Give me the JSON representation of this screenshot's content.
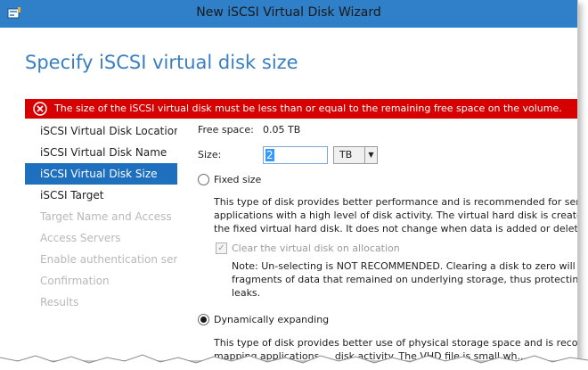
{
  "window": {
    "title": "New iSCSI Virtual Disk Wizard",
    "icon": "wizard-app-icon"
  },
  "page": {
    "title": "Specify iSCSI virtual disk size"
  },
  "error": {
    "icon": "error-x-icon",
    "message": "The size of the iSCSI virtual disk must be less than or equal to the remaining free space on the volume."
  },
  "nav": {
    "items": [
      {
        "label": "iSCSI Virtual Disk Location",
        "state": "normal"
      },
      {
        "label": "iSCSI Virtual Disk Name",
        "state": "normal"
      },
      {
        "label": "iSCSI Virtual Disk Size",
        "state": "selected"
      },
      {
        "label": "iSCSI Target",
        "state": "normal"
      },
      {
        "label": "Target Name and Access",
        "state": "disabled"
      },
      {
        "label": "Access Servers",
        "state": "disabled"
      },
      {
        "label": "Enable authentication ser...",
        "state": "disabled"
      },
      {
        "label": "Confirmation",
        "state": "disabled"
      },
      {
        "label": "Results",
        "state": "disabled"
      }
    ]
  },
  "form": {
    "free_space_label": "Free space:",
    "free_space_value": "0.05 TB",
    "size_label": "Size:",
    "size_value": "2",
    "unit_value": "TB",
    "fixed": {
      "label": "Fixed size",
      "checked": false,
      "desc_lines": [
        "This type of disk provides better performance and is recommended for server",
        "applications with a high level of disk activity. The virtual hard disk is created",
        "the fixed virtual hard disk. It does not change when data is added or deleted."
      ],
      "clear_label": "Clear the virtual disk on allocation",
      "clear_checked": true,
      "note_lines": [
        "Note: Un-selecting is NOT RECOMMENDED. Clearing a disk to zero will re",
        "fragments of data that remained on underlying storage, thus protecting",
        "leaks."
      ]
    },
    "dynamic": {
      "label": "Dynamically expanding",
      "checked": true,
      "desc_lines": [
        "This type of disk provides better use of physical storage space and is recomi",
        "mapping applications ... disk activity. The VHD file is small wh..."
      ]
    }
  },
  "colors": {
    "titlebar": "#2f7fc9",
    "accent_title": "#3a7ec2",
    "error_bg": "#d70000",
    "selected_nav": "#1e6fbd"
  }
}
